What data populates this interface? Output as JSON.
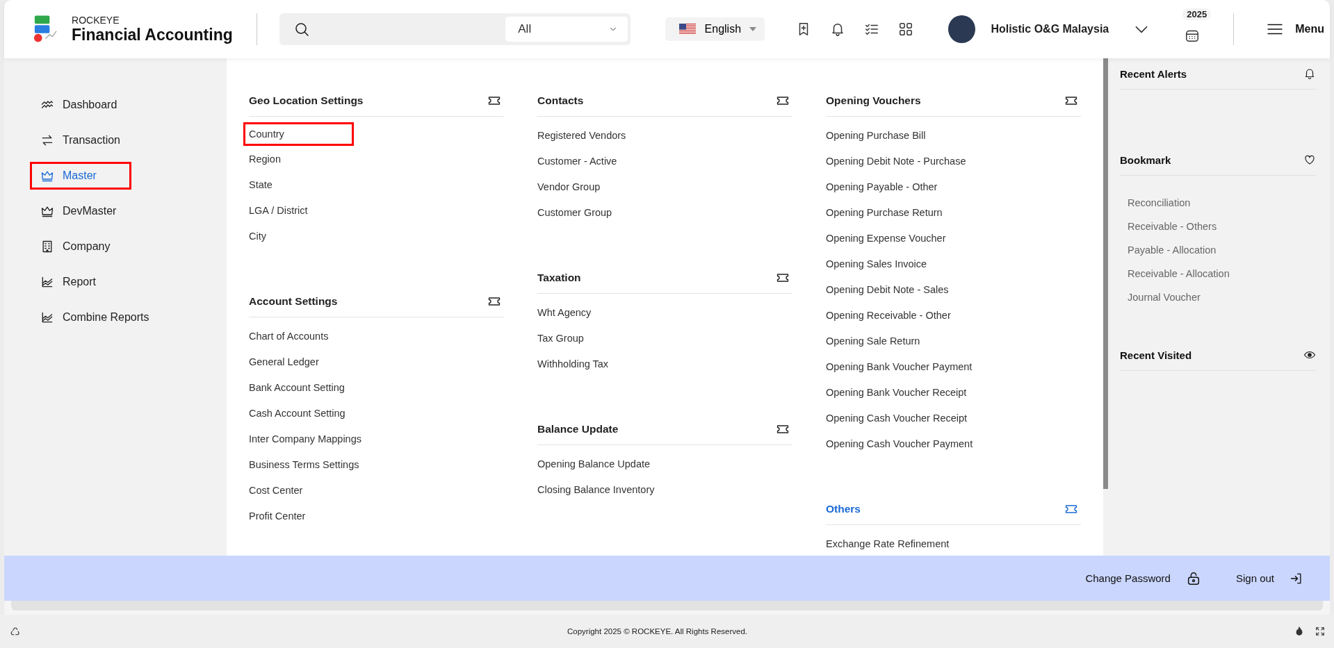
{
  "header": {
    "brand_small": "ROCKEYE",
    "brand_title": "Financial Accounting",
    "search_filter": "All",
    "language": "English",
    "user_name": "Holistic O&G Malaysia",
    "year_badge": "2025",
    "menu_label": "Menu"
  },
  "sidebar": {
    "items": [
      {
        "label": "Dashboard",
        "kind": "dashboard",
        "selected": false,
        "highlighted": false
      },
      {
        "label": "Transaction",
        "kind": "transaction",
        "selected": false,
        "highlighted": false
      },
      {
        "label": "Master",
        "kind": "master",
        "selected": true,
        "highlighted": true
      },
      {
        "label": "DevMaster",
        "kind": "master",
        "selected": false,
        "highlighted": false
      },
      {
        "label": "Company",
        "kind": "company",
        "selected": false,
        "highlighted": false
      },
      {
        "label": "Report",
        "kind": "report",
        "selected": false,
        "highlighted": false
      },
      {
        "label": "Combine Reports",
        "kind": "report",
        "selected": false,
        "highlighted": false
      }
    ]
  },
  "menu": {
    "columns": [
      {
        "sections": [
          {
            "title": "Geo Location Settings",
            "active": false,
            "items": [
              {
                "label": "Country",
                "highlighted": true
              },
              {
                "label": "Region",
                "highlighted": false
              },
              {
                "label": "State",
                "highlighted": false
              },
              {
                "label": "LGA / District",
                "highlighted": false
              },
              {
                "label": "City",
                "highlighted": false
              }
            ]
          },
          {
            "title": "Account Settings",
            "active": false,
            "items": [
              {
                "label": "Chart of Accounts",
                "highlighted": false
              },
              {
                "label": "General Ledger",
                "highlighted": false
              },
              {
                "label": "Bank Account Setting",
                "highlighted": false
              },
              {
                "label": "Cash Account Setting",
                "highlighted": false
              },
              {
                "label": "Inter Company Mappings",
                "highlighted": false
              },
              {
                "label": "Business Terms Settings",
                "highlighted": false
              },
              {
                "label": "Cost Center",
                "highlighted": false
              },
              {
                "label": "Profit Center",
                "highlighted": false
              }
            ]
          }
        ]
      },
      {
        "sections": [
          {
            "title": "Contacts",
            "active": false,
            "items": [
              {
                "label": "Registered Vendors",
                "highlighted": false
              },
              {
                "label": "Customer - Active",
                "highlighted": false
              },
              {
                "label": "Vendor Group",
                "highlighted": false
              },
              {
                "label": "Customer Group",
                "highlighted": false
              }
            ]
          },
          {
            "title": "Taxation",
            "active": false,
            "items": [
              {
                "label": "Wht Agency",
                "highlighted": false
              },
              {
                "label": "Tax Group",
                "highlighted": false
              },
              {
                "label": "Withholding Tax",
                "highlighted": false
              }
            ]
          },
          {
            "title": "Balance Update",
            "active": false,
            "items": [
              {
                "label": "Opening Balance Update",
                "highlighted": false
              },
              {
                "label": "Closing Balance Inventory",
                "highlighted": false
              }
            ]
          }
        ]
      },
      {
        "sections": [
          {
            "title": "Opening Vouchers",
            "active": false,
            "items": [
              {
                "label": "Opening Purchase Bill",
                "highlighted": false
              },
              {
                "label": "Opening Debit Note - Purchase",
                "highlighted": false
              },
              {
                "label": "Opening Payable - Other",
                "highlighted": false
              },
              {
                "label": "Opening Purchase Return",
                "highlighted": false
              },
              {
                "label": "Opening Expense Voucher",
                "highlighted": false
              },
              {
                "label": "Opening Sales Invoice",
                "highlighted": false
              },
              {
                "label": "Opening Debit Note - Sales",
                "highlighted": false
              },
              {
                "label": "Opening Receivable - Other",
                "highlighted": false
              },
              {
                "label": "Opening Sale Return",
                "highlighted": false
              },
              {
                "label": "Opening Bank Voucher Payment",
                "highlighted": false
              },
              {
                "label": "Opening Bank Voucher Receipt",
                "highlighted": false
              },
              {
                "label": "Opening Cash Voucher Receipt",
                "highlighted": false
              },
              {
                "label": "Opening Cash Voucher Payment",
                "highlighted": false
              }
            ]
          },
          {
            "title": "Others",
            "active": true,
            "items": [
              {
                "label": "Exchange Rate Refinement",
                "highlighted": false
              }
            ]
          }
        ]
      }
    ]
  },
  "right_panel": {
    "sections": [
      {
        "title": "Recent Alerts",
        "kind": "alerts"
      },
      {
        "title": "Bookmark",
        "kind": "bookmark",
        "items": [
          "Reconciliation",
          "Receivable - Others",
          "Payable - Allocation",
          "Receivable - Allocation",
          "Journal Voucher"
        ]
      },
      {
        "title": "Recent Visited",
        "kind": "visited"
      }
    ]
  },
  "footer_bar": {
    "actions": [
      {
        "label": "Change Password",
        "kind": "password"
      },
      {
        "label": "Sign out",
        "kind": "signout"
      }
    ]
  },
  "status_bar": {
    "copyright": "Copyright 2025 © ROCKEYE. All Rights Reserved."
  }
}
